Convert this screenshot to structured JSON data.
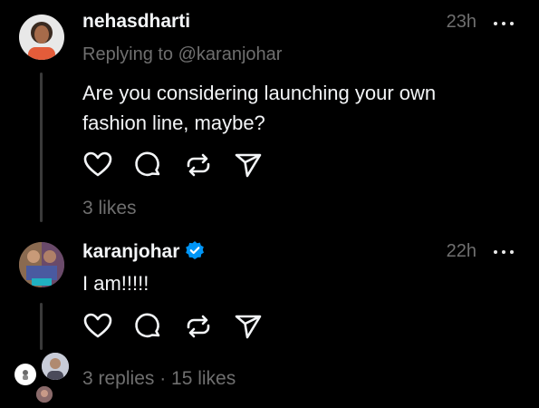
{
  "post1": {
    "username": "nehasdharti",
    "time": "23h",
    "replying_to": "Replying to @karanjohar",
    "text_line1": "Are you considering launching your own",
    "text_line2": "fashion line, maybe?",
    "likes": "3 likes",
    "icons": [
      "heart-icon",
      "comment-icon",
      "repost-icon",
      "share-icon",
      "more-icon"
    ]
  },
  "post2": {
    "username": "karanjohar",
    "verified": true,
    "time": "22h",
    "text": "I am!!!!!",
    "meta": "3 replies · 15 likes",
    "icons": [
      "verified-badge-icon",
      "heart-icon",
      "comment-icon",
      "repost-icon",
      "share-icon",
      "more-icon"
    ]
  },
  "colors": {
    "background": "#000000",
    "primary_text": "#f3f5f7",
    "secondary_text": "#6f6f6f",
    "thread_line": "#3a3a3a",
    "verified_blue": "#0095f6"
  }
}
